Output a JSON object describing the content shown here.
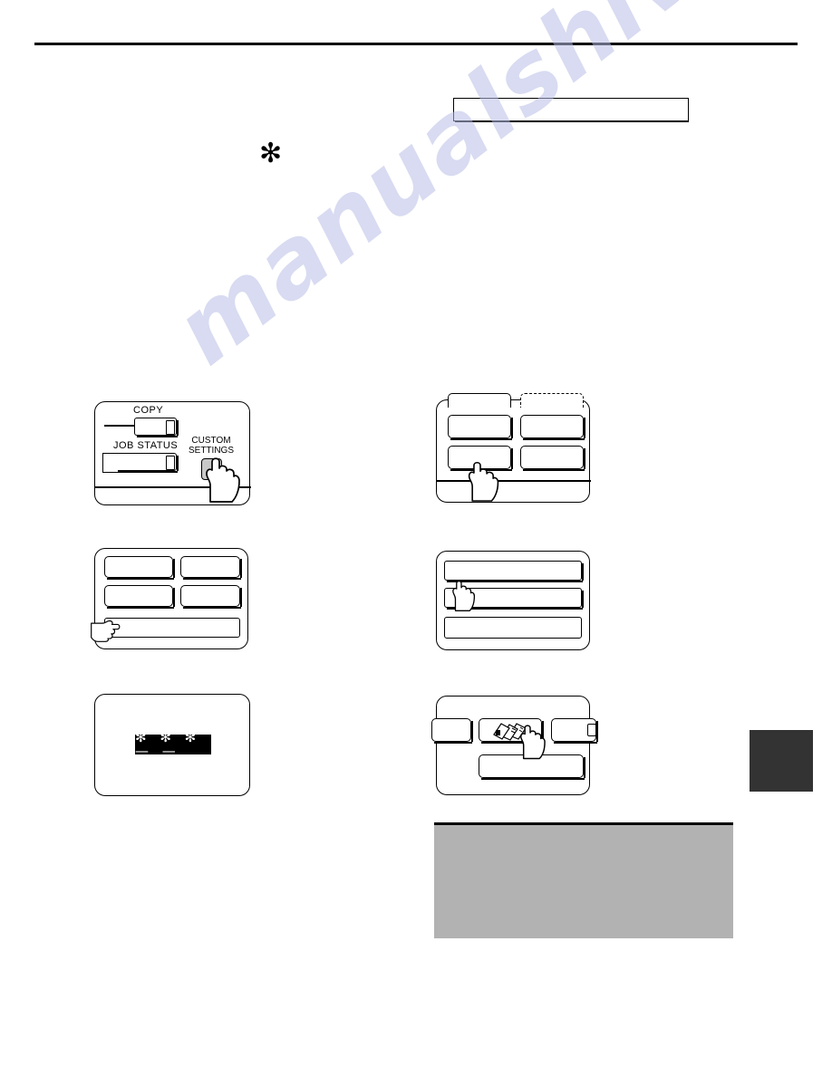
{
  "document": {
    "type": "scanned-manual-page",
    "watermark_text": "manualshive.com"
  },
  "header": {
    "caption_box_text": "",
    "footnote_marker": "✻"
  },
  "steps": [
    {
      "id": "step-1",
      "name": "operation-panel-custom-settings",
      "keys": [
        {
          "label": "COPY",
          "name": "copy-key"
        },
        {
          "label": "JOB  STATUS",
          "name": "job-status-key"
        },
        {
          "label": "CUSTOM\nSETTINGS",
          "name": "custom-settings-key",
          "pressed": true
        }
      ],
      "custom_settings_line1": "CUSTOM",
      "custom_settings_line2": "SETTINGS",
      "copy_label": "COPY",
      "job_status_label": "JOB  STATUS"
    },
    {
      "id": "step-2",
      "name": "custom-settings-menu-screen",
      "tabs": [
        "",
        ""
      ],
      "buttons": [
        "",
        "",
        "",
        ""
      ],
      "touched_button_index": 2
    },
    {
      "id": "step-3",
      "name": "settings-list-screen",
      "buttons": [
        "",
        "",
        "",
        ""
      ],
      "bottom_bar_label": "",
      "touched_target": "bottom-bar"
    },
    {
      "id": "step-4",
      "name": "admin-program-list-screen",
      "rows": [
        "",
        "",
        ""
      ],
      "touched_row_index": 1
    },
    {
      "id": "step-5",
      "name": "password-entry-screen",
      "display_value": "✻ ✻ ✻ — —",
      "display_background": "#000000",
      "display_foreground": "#ffffff"
    },
    {
      "id": "step-6",
      "name": "function-select-screen",
      "buttons": [
        "",
        "",
        ""
      ],
      "center_button_icon": "printed-sheets-icon",
      "bottom_bar_label": "",
      "touched_button_index": 1
    }
  ],
  "note": {
    "name": "gray-note-block",
    "text": "",
    "background": "#b2b2b2"
  },
  "page_tab": {
    "name": "chapter-edge-tab",
    "label": "",
    "color": "#333333"
  }
}
